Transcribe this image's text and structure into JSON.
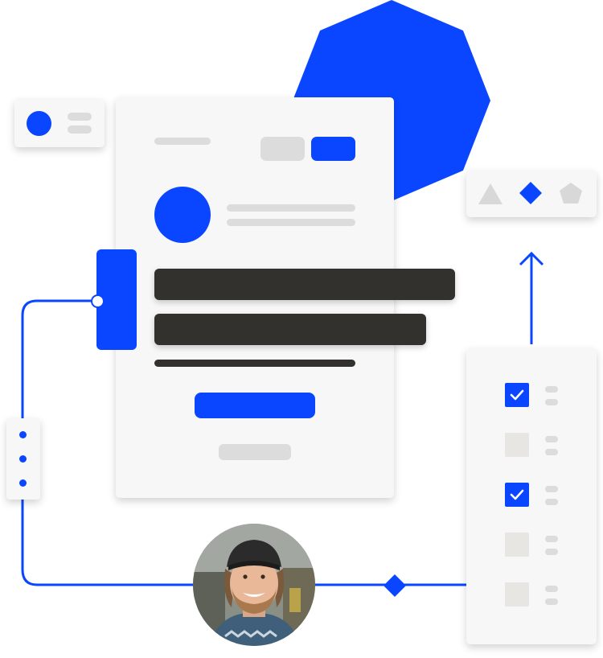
{
  "colors": {
    "accent": "#0a46ff",
    "dark": "#33312d",
    "placeholder": "#dcdcdc",
    "card": "#f7f7f7"
  },
  "shape_picker": {
    "icons": [
      "triangle-icon",
      "diamond-icon",
      "pentagon-icon"
    ],
    "selected": "diamond-icon"
  },
  "checklist": {
    "items": [
      {
        "checked": true
      },
      {
        "checked": false
      },
      {
        "checked": true
      },
      {
        "checked": false
      },
      {
        "checked": false
      }
    ]
  },
  "profile": {
    "avatar": "user-photo"
  }
}
